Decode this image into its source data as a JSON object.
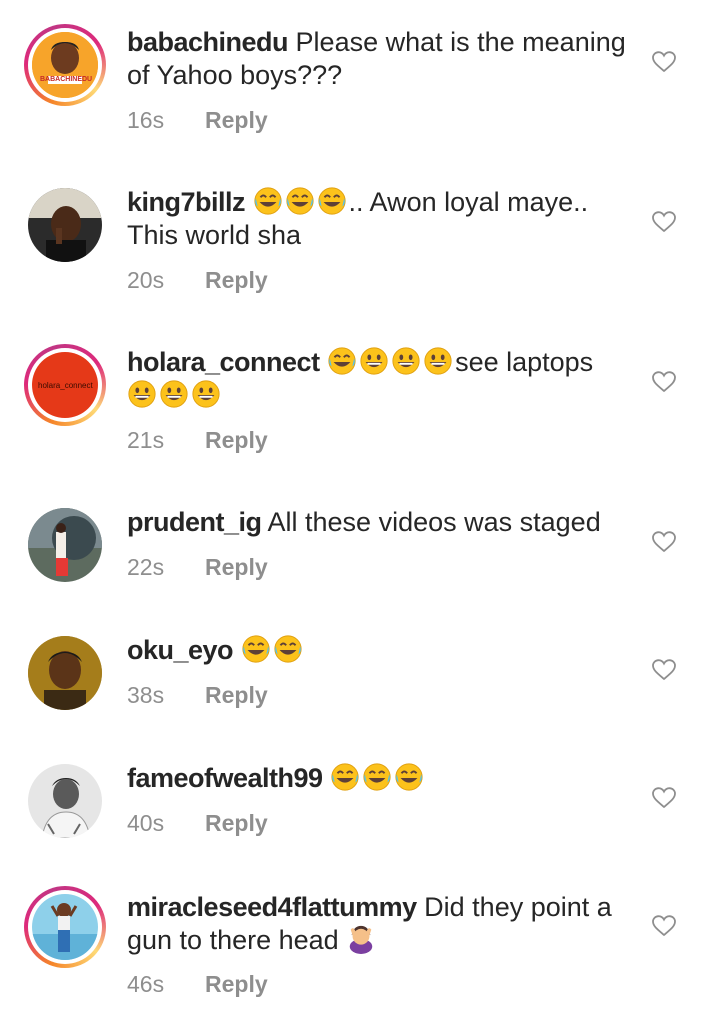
{
  "comments": [
    {
      "user": "babachinedu",
      "text": "Please what is the meaning of Yahoo boys???",
      "time": "16s",
      "reply": "Reply",
      "avatar_text": "BABACHINEDU"
    },
    {
      "user": "king7billz",
      "text": ".. Awon loyal maye.. This world sha",
      "time": "20s",
      "reply": "Reply"
    },
    {
      "user": "holara_connect",
      "text": "see laptops",
      "time": "21s",
      "reply": "Reply",
      "avatar_text": "holara_connect"
    },
    {
      "user": "prudent_ig",
      "text": "All these videos was staged",
      "time": "22s",
      "reply": "Reply"
    },
    {
      "user": "oku_eyo",
      "text": "",
      "time": "38s",
      "reply": "Reply"
    },
    {
      "user": "fameofwealth99",
      "text": "",
      "time": "40s",
      "reply": "Reply"
    },
    {
      "user": "miracleseed4flattummy",
      "text": "Did they point a gun to there head",
      "time": "46s",
      "reply": "Reply"
    }
  ],
  "colors": {
    "heart": "#8e8e8e",
    "meta": "#8e8e8e",
    "text": "#262626",
    "ring_start": "#f58529",
    "ring_mid": "#dd2a7b"
  },
  "icons": {
    "like": "heart-outline-icon",
    "laugh": "tears-of-joy-emoji",
    "grin": "grinning-emoji",
    "facepalm": "person-gesturing-emoji"
  }
}
